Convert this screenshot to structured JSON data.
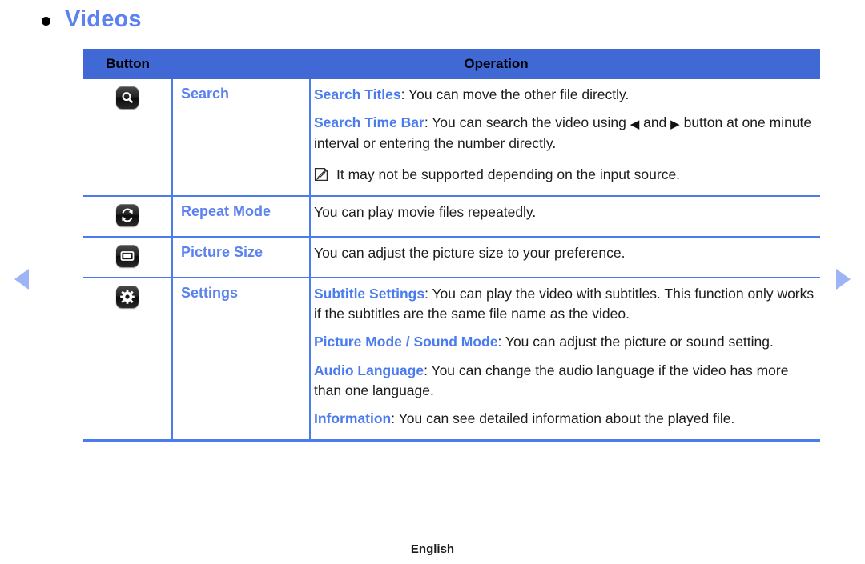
{
  "page": {
    "title": "Videos",
    "bullet_icon": "bullet-dot-icon",
    "footer_label": "English"
  },
  "nav": {
    "prev_icon": "triangle-left-icon",
    "next_icon": "triangle-right-icon"
  },
  "table": {
    "headers": {
      "button": "Button",
      "operation": "Operation"
    },
    "rows": [
      {
        "icon": "search-icon",
        "name": "Search",
        "lines": [
          {
            "key": "Search Titles",
            "sep": ": ",
            "text": "You can move the other file directly."
          },
          {
            "key": "Search Time Bar",
            "sep": ": ",
            "pre": "You can search the video using ",
            "arrow_left": "◀",
            "mid": " and ",
            "arrow_right": "▶",
            "post": " button at one minute interval or entering the number directly."
          }
        ],
        "note": {
          "icon": "note-pencil-icon",
          "text": "It may not be supported depending on the input source."
        }
      },
      {
        "icon": "repeat-icon",
        "name": "Repeat Mode",
        "lines": [
          {
            "key": "",
            "sep": "",
            "text": "You can play movie files repeatedly."
          }
        ]
      },
      {
        "icon": "picture-size-icon",
        "name": "Picture Size",
        "lines": [
          {
            "key": "",
            "sep": "",
            "text": "You can adjust the picture size to your preference."
          }
        ]
      },
      {
        "icon": "settings-gear-icon",
        "name": "Settings",
        "lines": [
          {
            "key": "Subtitle Settings",
            "sep": ": ",
            "text": "You can play the video with subtitles. This function only works if the subtitles are the same file name as the video."
          },
          {
            "key": "Picture Mode / Sound Mode",
            "sep": ": ",
            "text": "You can adjust the picture or sound setting."
          },
          {
            "key": "Audio Language",
            "sep": ": ",
            "text": "You can change the audio language if the video has more than one language."
          },
          {
            "key": "Information",
            "sep": ": ",
            "text": "You can see detailed information about the played file."
          }
        ]
      }
    ]
  },
  "colors": {
    "title_blue": "#5b82f0",
    "header_blue": "#4069d6",
    "border_blue": "#4a7bef",
    "key_blue": "#4a7bef",
    "arrow_blue": "#9db4f7",
    "body_text": "#1c1c1c"
  }
}
